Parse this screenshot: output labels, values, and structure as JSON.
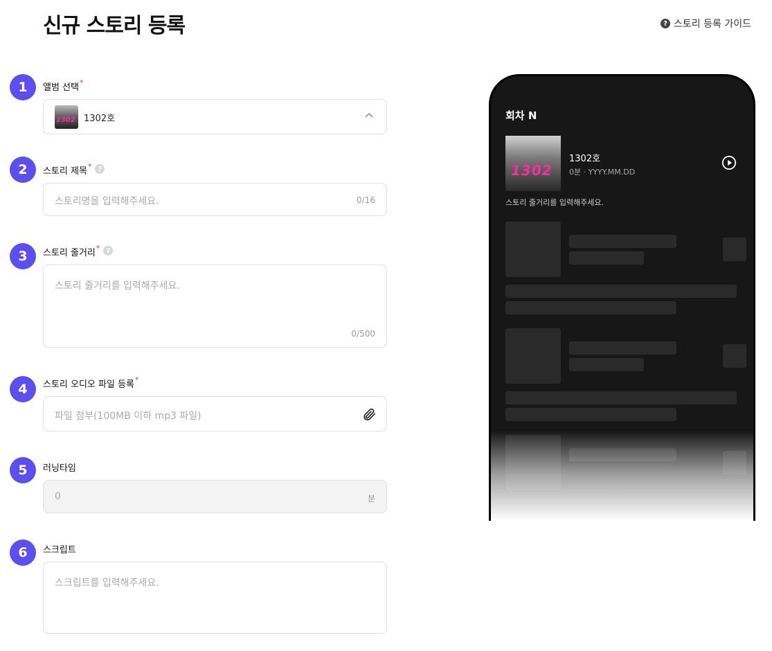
{
  "page": {
    "title": "신규 스토리 등록",
    "guide_link": "스토리 등록 가이드"
  },
  "steps": {
    "s1": "1",
    "s2": "2",
    "s3": "3",
    "s4": "4",
    "s5": "5",
    "s6": "6"
  },
  "form": {
    "album": {
      "label": "앨범 선택",
      "value": "1302호",
      "cover_text": "1302"
    },
    "title": {
      "label": "스토리 제목",
      "placeholder": "스토리명을 입력해주세요.",
      "count": "0/16"
    },
    "summary": {
      "label": "스토리 줄거리",
      "placeholder": "스토리 줄거리를 입력해주세요.",
      "count": "0/500"
    },
    "audio": {
      "label": "스토리 오디오 파일 등록",
      "placeholder": "파일 첨부(100MB 이하 mp3 파일)"
    },
    "runtime": {
      "label": "러닝타임",
      "value": "0",
      "unit": "분"
    },
    "script": {
      "label": "스크립트",
      "placeholder": "스크립트를 입력해주세요."
    }
  },
  "preview": {
    "header": "회차 N",
    "cover_text": "1302",
    "episode_name": "1302호",
    "episode_meta": "0분 · YYYY.MM.DD",
    "description": "스토리 줄거리를 입력해주세요."
  },
  "icons": {
    "guide": "question-circle-icon",
    "help": "question-circle-icon",
    "chevron": "chevron-up-icon",
    "attach": "paperclip-icon",
    "play": "play-circle-icon"
  },
  "colors": {
    "accent": "#5b4ff0",
    "required": "#e53935",
    "preview_bg": "#171717"
  }
}
